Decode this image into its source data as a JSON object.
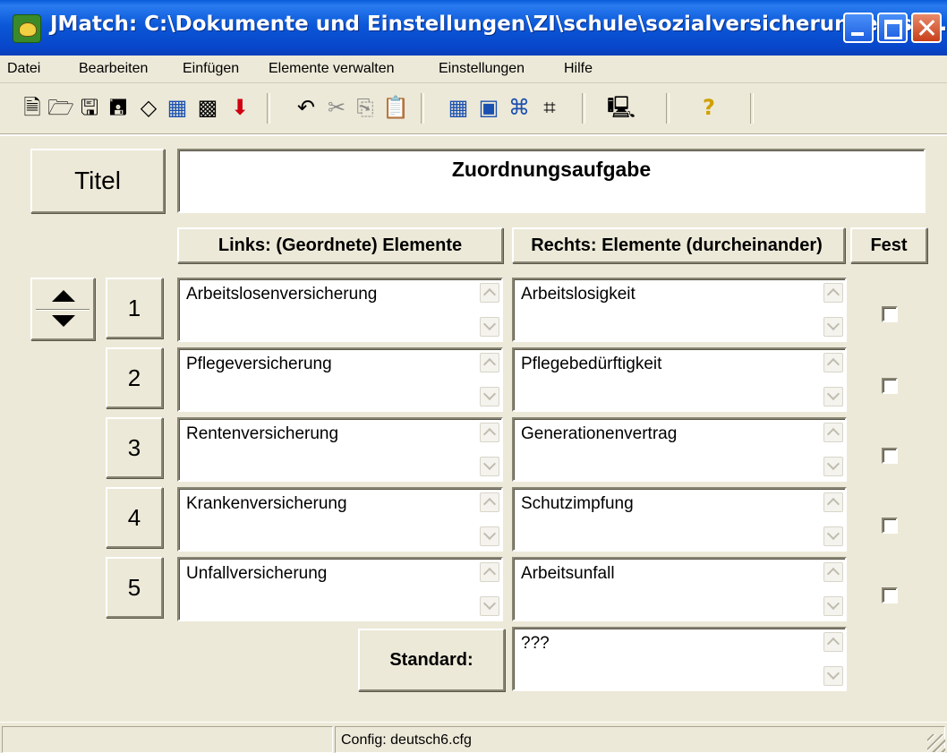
{
  "window": {
    "title": "JMatch: C:\\Dokumente und Einstellungen\\ZI\\schule\\sozialversicherungen\\so…"
  },
  "menu": [
    "Datei",
    "Bearbeiten",
    "Einfügen",
    "Elemente verwalten",
    "Einstellungen",
    "Hilfe"
  ],
  "toolbar": {
    "icons": [
      "new-file-icon",
      "open-folder-icon",
      "save-icon",
      "save-as-icon",
      "eraser-icon",
      "export-web-icon",
      "export-web-alt-icon",
      "arrow-down-icon",
      "undo-icon",
      "cut-icon",
      "copy-icon",
      "paste-icon",
      "crossword-icon",
      "image-icon",
      "link-icon",
      "link-alt-icon",
      "monitor-icon",
      "help-icon"
    ],
    "help_glyph": "?"
  },
  "form": {
    "title_label": "Titel",
    "title_value": "Zuordnungsaufgabe",
    "header_left": "Links: (Geordnete) Elemente",
    "header_right": "Rechts: Elemente (durcheinander)",
    "header_fixed": "Fest",
    "rows": [
      {
        "num": "1",
        "left": "Arbeitslosenversicherung",
        "right": "Arbeitslosigkeit",
        "fixed": false
      },
      {
        "num": "2",
        "left": "Pflegeversicherung",
        "right": "Pflegebedürftigkeit",
        "fixed": false
      },
      {
        "num": "3",
        "left": "Rentenversicherung",
        "right": "Generationenvertrag",
        "fixed": false
      },
      {
        "num": "4",
        "left": "Krankenversicherung",
        "right": "Schutzimpfung",
        "fixed": false
      },
      {
        "num": "5",
        "left": "Unfallversicherung",
        "right": "Arbeitsunfall",
        "fixed": false
      }
    ],
    "default_label": "Standard:",
    "default_value": "???"
  },
  "status": {
    "config": "Config: deutsch6.cfg"
  }
}
